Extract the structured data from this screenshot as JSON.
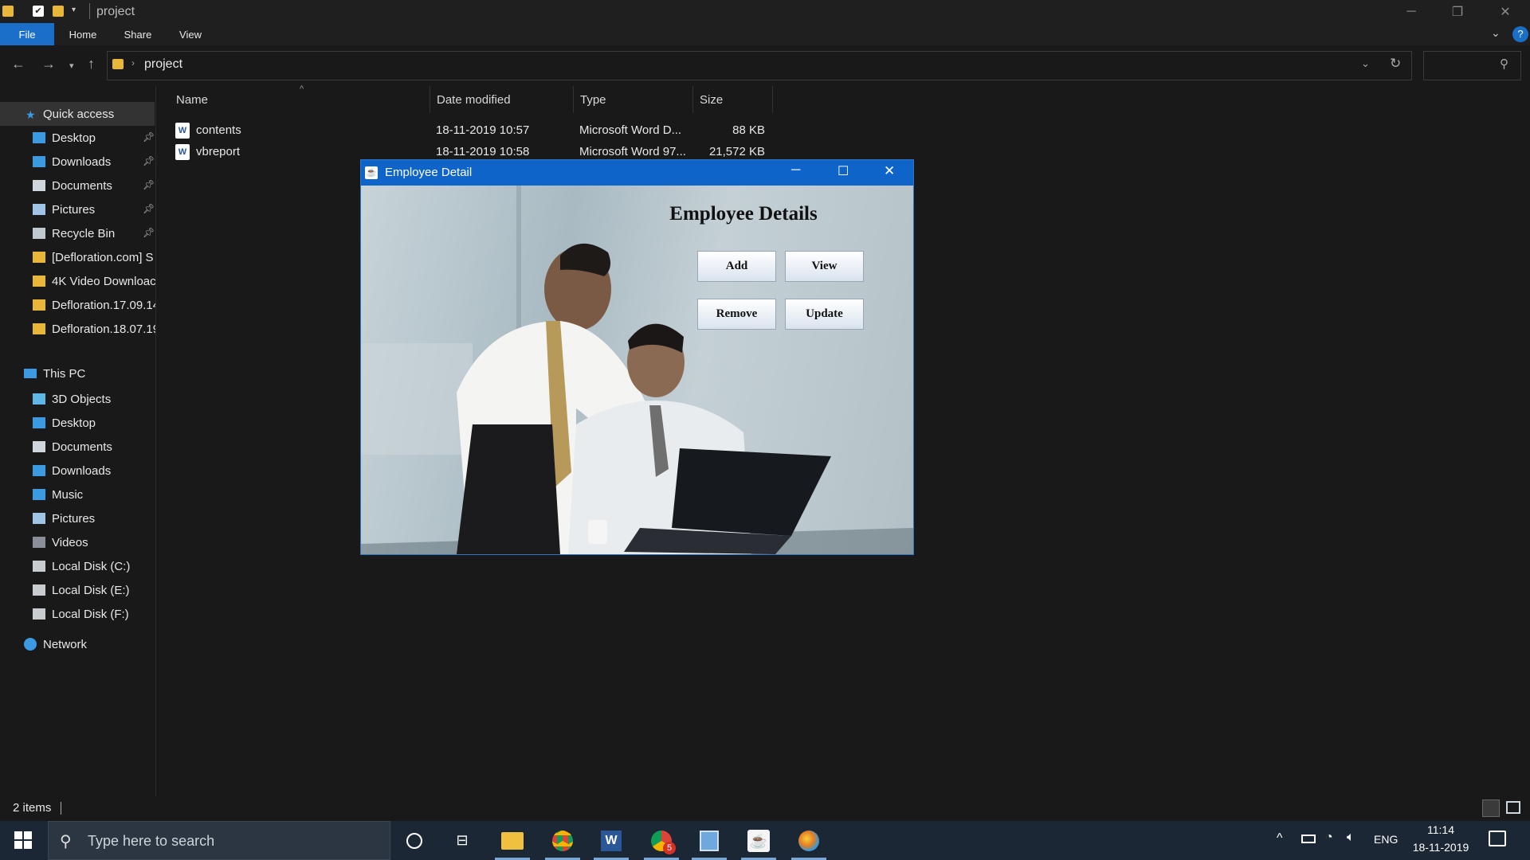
{
  "explorer": {
    "window_title": "project",
    "ribbon_tabs": [
      "File",
      "Home",
      "Share",
      "View"
    ],
    "address_path": "project",
    "columns": {
      "name": "Name",
      "date": "Date modified",
      "type": "Type",
      "size": "Size"
    },
    "files": [
      {
        "name": "contents",
        "date": "18-11-2019 10:57",
        "type": "Microsoft Word D...",
        "size": "88 KB",
        "icon": "word-doc-icon"
      },
      {
        "name": "vbreport",
        "date": "18-11-2019 10:58",
        "type": "Microsoft Word 97...",
        "size": "21,572 KB",
        "icon": "word-doc-icon"
      }
    ],
    "sidebar": {
      "quick_access": "Quick access",
      "quick_items": [
        {
          "label": "Desktop",
          "icon": "desktop-icon",
          "pinned": true
        },
        {
          "label": "Downloads",
          "icon": "downloads-icon",
          "pinned": true
        },
        {
          "label": "Documents",
          "icon": "documents-icon",
          "pinned": true
        },
        {
          "label": "Pictures",
          "icon": "pictures-icon",
          "pinned": true
        },
        {
          "label": "Recycle Bin",
          "icon": "recycle-bin-icon",
          "pinned": true
        },
        {
          "label": "[Defloration.com] S",
          "icon": "folder-icon",
          "pinned": false
        },
        {
          "label": "4K Video Downloac",
          "icon": "folder-icon",
          "pinned": false
        },
        {
          "label": "Defloration.17.09.14",
          "icon": "folder-icon",
          "pinned": false
        },
        {
          "label": "Defloration.18.07.19",
          "icon": "folder-icon",
          "pinned": false
        }
      ],
      "this_pc": "This PC",
      "pc_items": [
        {
          "label": "3D Objects",
          "icon": "3d-objects-icon"
        },
        {
          "label": "Desktop",
          "icon": "desktop-icon"
        },
        {
          "label": "Documents",
          "icon": "documents-icon"
        },
        {
          "label": "Downloads",
          "icon": "downloads-icon"
        },
        {
          "label": "Music",
          "icon": "music-icon"
        },
        {
          "label": "Pictures",
          "icon": "pictures-icon"
        },
        {
          "label": "Videos",
          "icon": "videos-icon"
        },
        {
          "label": "Local Disk (C:)",
          "icon": "drive-icon"
        },
        {
          "label": "Local Disk (E:)",
          "icon": "drive-icon"
        },
        {
          "label": "Local Disk (F:)",
          "icon": "drive-icon"
        }
      ],
      "network": "Network"
    },
    "status_text": "2 items"
  },
  "dialog": {
    "title": "Employee Detail",
    "heading": "Employee Details",
    "buttons": {
      "add": "Add",
      "view": "View",
      "remove": "Remove",
      "update": "Update"
    }
  },
  "taskbar": {
    "search_placeholder": "Type here to search",
    "language": "ENG",
    "time": "11:14",
    "date": "18-11-2019",
    "badge_count": "5"
  },
  "colors": {
    "accent": "#1a6fc9",
    "dialog_title": "#0e64c9",
    "background": "#191919"
  }
}
